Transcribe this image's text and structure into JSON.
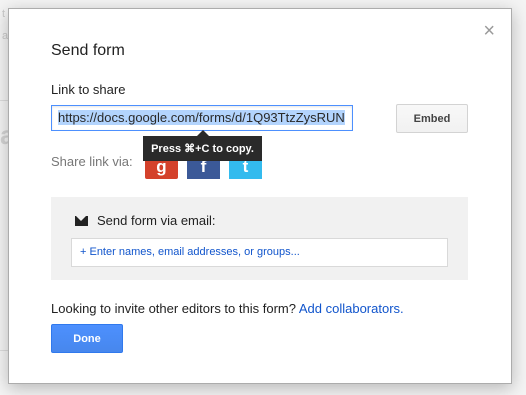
{
  "dialog": {
    "title": "Send form",
    "close_glyph": "×",
    "link_label": "Link to share",
    "link_value": "https://docs.google.com/forms/d/1Q93TtzZysRUN",
    "embed_label": "Embed",
    "share_label": "Share link via:",
    "tooltip": "Press ⌘+C to copy.",
    "social": [
      {
        "name": "google-plus-icon",
        "glyph": "g",
        "color": "#d4412b"
      },
      {
        "name": "facebook-icon",
        "glyph": "f",
        "color": "#3b5998"
      },
      {
        "name": "twitter-icon",
        "glyph": "t",
        "color": "#33bbee"
      }
    ],
    "email_heading": "Send form via email:",
    "email_placeholder": "+ Enter names, email addresses, or groups...",
    "invite_text": "Looking to invite other editors to this form?",
    "invite_link": "Add collaborators.",
    "done_label": "Done"
  }
}
